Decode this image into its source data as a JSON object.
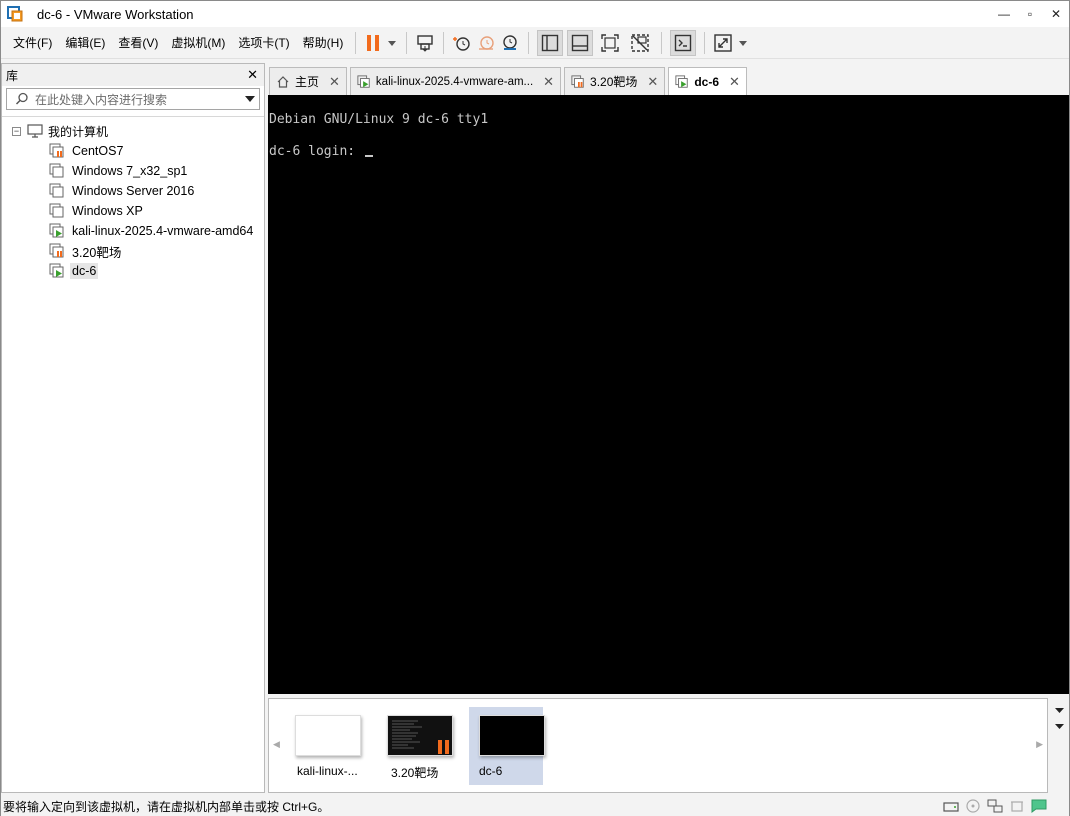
{
  "window": {
    "title": "dc-6 - VMware Workstation",
    "controls": {
      "minimize": "—",
      "maximize": "▫",
      "close": "✕"
    }
  },
  "menu": [
    "文件(F)",
    "编辑(E)",
    "查看(V)",
    "虚拟机(M)",
    "选项卡(T)",
    "帮助(H)"
  ],
  "toolbar": {
    "accent": "#f26b1d",
    "icons": [
      "pause-icon",
      "dropdown-arrow-icon",
      "send-ctrl-alt-del-icon",
      "snapshot-icon",
      "revert-snapshot-icon",
      "snapshot-manager-icon",
      "library-view-icon",
      "thumbnail-bar-icon",
      "full-screen-icon",
      "unity-icon",
      "console-view-icon",
      "stretch-icon",
      "stretch-dropdown-icon"
    ]
  },
  "library": {
    "title": "库",
    "close": "✕",
    "search_placeholder": "在此处键入内容进行搜索",
    "root": {
      "toggle": "−",
      "label": "我的计算机"
    },
    "items": [
      {
        "label": "CentOS7",
        "state": "paused"
      },
      {
        "label": "Windows 7_x32_sp1",
        "state": "off"
      },
      {
        "label": "Windows Server 2016",
        "state": "off"
      },
      {
        "label": "Windows XP",
        "state": "off"
      },
      {
        "label": "kali-linux-2025.4-vmware-amd64",
        "state": "running"
      },
      {
        "label": "3.20靶场",
        "state": "paused"
      },
      {
        "label": "dc-6",
        "state": "running",
        "selected": true
      }
    ]
  },
  "tabs": [
    {
      "label": "主页",
      "close": "✕",
      "icon": "home-icon"
    },
    {
      "label": "kali-linux-2025.4-vmware-am...",
      "close": "✕",
      "icon": "vm-running-icon"
    },
    {
      "label": "3.20靶场",
      "close": "✕",
      "icon": "vm-paused-icon"
    },
    {
      "label": "dc-6",
      "close": "✕",
      "icon": "vm-running-icon",
      "active": true
    }
  ],
  "console": {
    "line1": "Debian GNU/Linux 9 dc-6 tty1",
    "line2": "dc-6 login: "
  },
  "thumbnails": [
    {
      "label": "kali-linux-...",
      "screen": "white",
      "paused": false
    },
    {
      "label": "3.20靶场",
      "screen": "dark",
      "paused": true
    },
    {
      "label": "dc-6",
      "screen": "black",
      "paused": false,
      "selected": true
    }
  ],
  "statusbar": {
    "message": "要将输入定向到该虚拟机，请在虚拟机内部单击或按 Ctrl+G。",
    "icons": [
      "hard-disk-icon",
      "cd-icon",
      "network-icon",
      "usb-icon",
      "message-icon"
    ]
  }
}
